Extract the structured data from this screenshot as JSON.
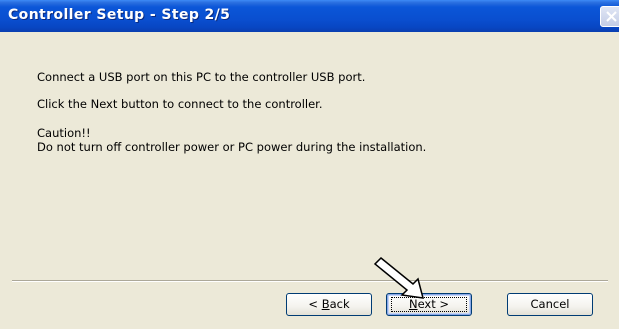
{
  "window": {
    "title": "Controller Setup - Step 2/5",
    "close_icon": "close-icon"
  },
  "content": {
    "line1": "Connect a USB port on this PC to the controller USB port.",
    "line2": "Click the Next button to connect to the controller.",
    "caution_title": "Caution!!",
    "caution_text": "Do not turn off controller power or PC power during the installation."
  },
  "buttons": {
    "back_prefix": "< ",
    "back_accel": "B",
    "back_rest": "ack",
    "next_accel": "N",
    "next_rest": "ext >",
    "cancel": "Cancel"
  },
  "overlay": {
    "pointer_icon": "arrow-pointer-icon"
  },
  "colors": {
    "titlebar": "#0a4fd0",
    "dialog_bg": "#ece9d8",
    "button_border": "#003c74"
  }
}
